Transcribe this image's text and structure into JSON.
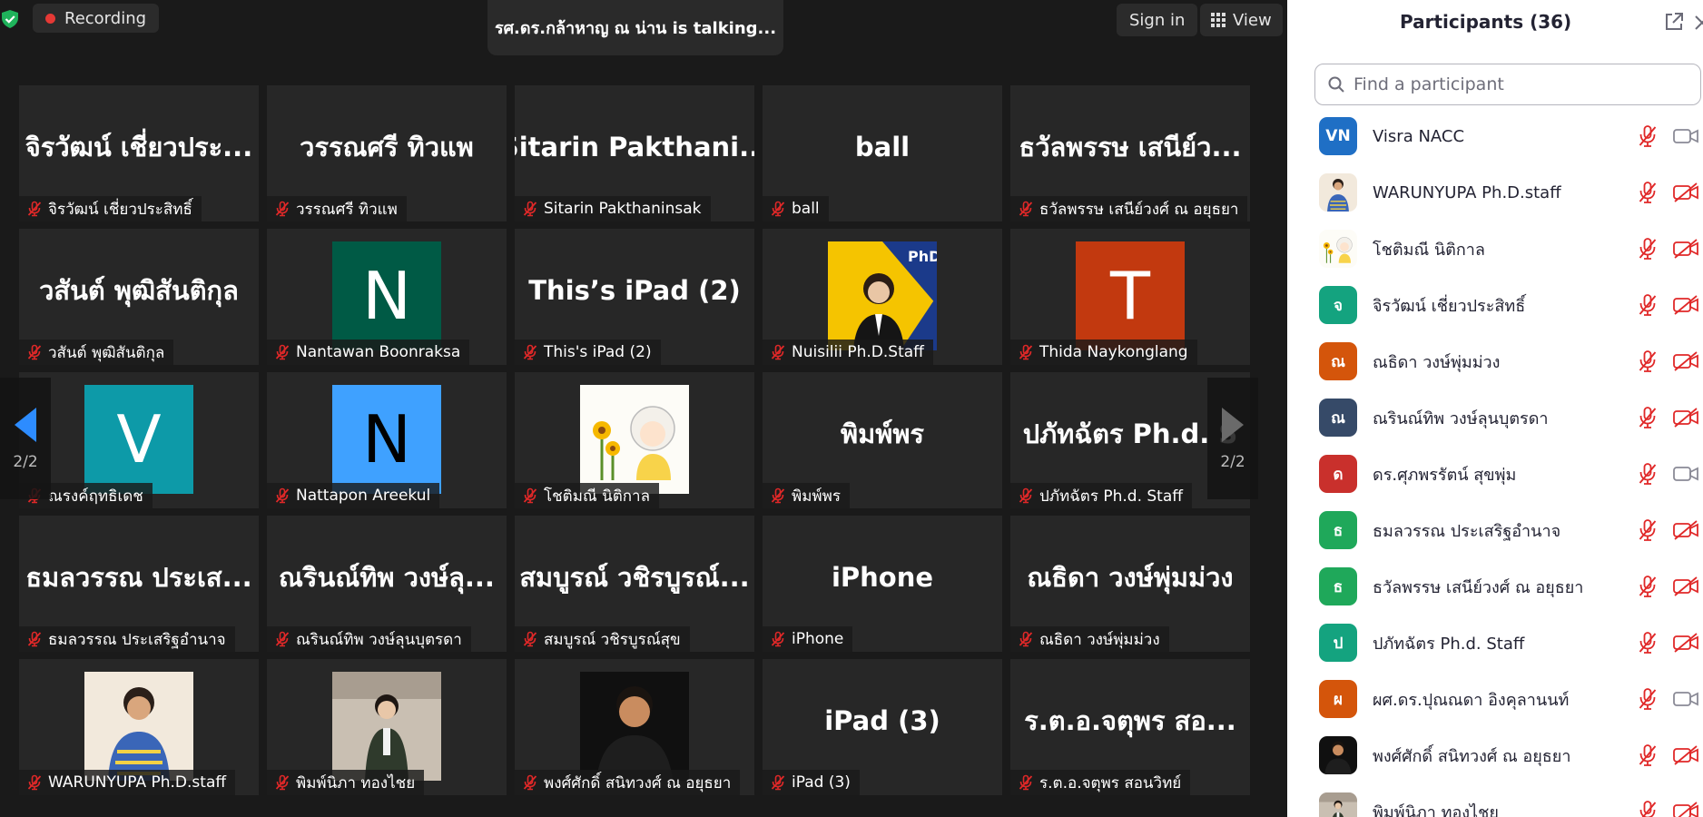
{
  "topbar": {
    "recording_label": "Recording",
    "talking_text": "รศ.ดร.กล้าหาญ  ณ น่าน is talking...",
    "signin_label": "Sign in",
    "view_label": "View"
  },
  "colors": {
    "recording_dot": "#e53935",
    "shield": "#1fb35b",
    "mic_muted": "#e02828",
    "nav_arrow": "#2d8cff"
  },
  "grid": {
    "page_indicator": "2/2",
    "tiles": [
      {
        "big": "จิรวัฒน์ เชี่ยวประ...",
        "label": "จิรวัฒน์ เชี่ยวประสิทธิ์"
      },
      {
        "big": "วรรณศรี  ทิวแพ",
        "label": "วรรณศรี  ทิวแพ"
      },
      {
        "big": "Sitarin  Pakthani...",
        "label": "Sitarin Pakthaninsak"
      },
      {
        "big": "ball",
        "label": "ball"
      },
      {
        "big": "ธวัลพรรษ เสนีย์ว...",
        "label": "ธวัลพรรษ เสนีย์วงศ์ ณ อยุธยา"
      },
      {
        "big": "วสันต์ พุฒิสันติกุล",
        "label": "วสันต์ พุฒิสันติกุล"
      },
      {
        "avatar": "N",
        "avatar_color": "#005a45",
        "label": "Nantawan Boonraksa"
      },
      {
        "big": "This’s iPad (2)",
        "label": "This's iPad (2)"
      },
      {
        "avatar_img": "phd",
        "label": "Nuisilii Ph.D.Staff"
      },
      {
        "avatar": "T",
        "avatar_color": "#c2390f",
        "label": "Thida Naykonglang"
      },
      {
        "avatar": "V",
        "avatar_color": "#0d9aa8",
        "label": "ณรงค์ฤทธิเดช"
      },
      {
        "avatar": "N",
        "avatar_color": "#3fa1ff",
        "avatar_text_color": "#000000",
        "label": "Nattapon Areekul"
      },
      {
        "avatar_img": "sunflower",
        "label": "โชติมณี นิติกาล"
      },
      {
        "big": "พิมพ์พร",
        "label": "พิมพ์พร"
      },
      {
        "big": "ปภัทฉัตร Ph.d. S",
        "label": "ปภัทฉัตร Ph.d. Staff"
      },
      {
        "big": "ธมลวรรณ ประเส...",
        "label": "ธมลวรรณ ประเสริฐอำนาจ"
      },
      {
        "big": "ณรินณ์ทิพ วงษ์ลุ...",
        "label": "ณรินณ์ทิพ วงษ์ลุนบุตรดา"
      },
      {
        "big": "สมบูรณ์ วชิรบูรณ์...",
        "label": "สมบูรณ์ วชิรบูรณ์สุข"
      },
      {
        "big": "iPhone",
        "label": "iPhone"
      },
      {
        "big": "ณธิดา วงษ์พุ่มม่วง",
        "label": "ณธิดา วงษ์พุ่มม่วง"
      },
      {
        "avatar_img": "woman",
        "label": "WARUNYUPA Ph.D.staff"
      },
      {
        "avatar_img": "uniform",
        "label": "พิมพ์นิภา ทองไชย"
      },
      {
        "avatar_img": "man",
        "label": "พงศ์ศักดิ์ สนิทวงศ์ ณ อยุธยา"
      },
      {
        "big": "iPad (3)",
        "label": "iPad (3)"
      },
      {
        "big": "ร.ต.อ.จตุพร  สอ...",
        "label": "ร.ต.อ.จตุพร  สอนวิทย์"
      }
    ]
  },
  "participants": {
    "title": "Participants (36)",
    "search_placeholder": "Find a participant",
    "items": [
      {
        "initial": "VN",
        "color": "#1f6fc5",
        "name": "Visra NACC",
        "video_on": true
      },
      {
        "img": "woman",
        "name": "WARUNYUPA Ph.D.staff",
        "video_on": false
      },
      {
        "img": "sunflower",
        "name": "โชติมณี นิติกาล",
        "video_on": false
      },
      {
        "initial": "จ",
        "color": "#14a37f",
        "name": "จิรวัฒน์ เชี่ยวประสิทธิ์",
        "video_on": false
      },
      {
        "initial": "ณ",
        "color": "#d4550b",
        "name": "ณธิดา วงษ์พุ่มม่วง",
        "video_on": false
      },
      {
        "initial": "ณ",
        "color": "#364a68",
        "name": "ณรินณ์ทิพ วงษ์ลุนบุตรดา",
        "video_on": false
      },
      {
        "initial": "ด",
        "color": "#c9302c",
        "name": "ดร.ศุภพรรัตน์ สุขพุ่ม",
        "video_on": true
      },
      {
        "initial": "ธ",
        "color": "#1fa85a",
        "name": "ธมลวรรณ ประเสริฐอำนาจ",
        "video_on": false
      },
      {
        "initial": "ธ",
        "color": "#1fa85a",
        "name": "ธวัลพรรษ เสนีย์วงศ์ ณ อยุธยา",
        "video_on": false
      },
      {
        "initial": "ป",
        "color": "#14a37f",
        "name": "ปภัทฉัตร Ph.d. Staff",
        "video_on": false
      },
      {
        "initial": "ผ",
        "color": "#d4550b",
        "name": "ผศ.ดร.ปุณณดา อิงคุลานนท์",
        "video_on": true
      },
      {
        "img": "man",
        "name": "พงศ์ศักดิ์ สนิทวงศ์ ณ อยุธยา",
        "video_on": false
      },
      {
        "img": "uniform",
        "name": "พิมพ์นิภา ทองไชย",
        "video_on": false
      }
    ]
  }
}
